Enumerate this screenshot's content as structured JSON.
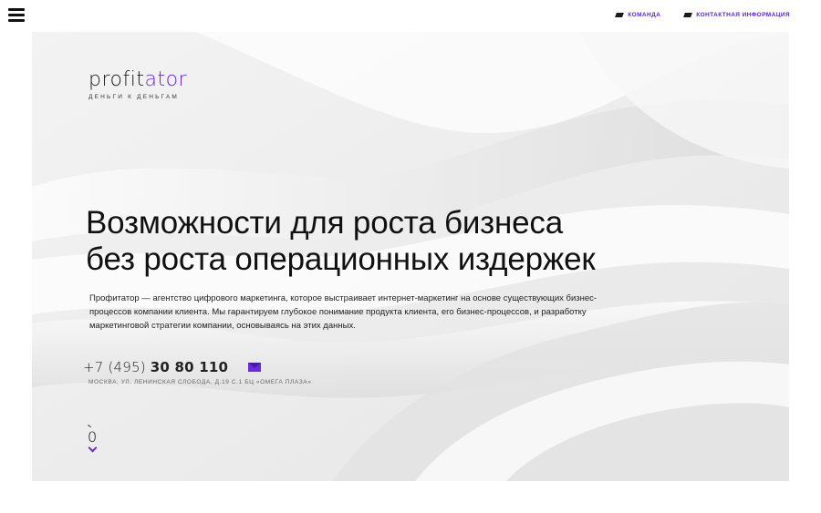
{
  "nav": {
    "menu_icon": "hamburger-icon",
    "links": [
      {
        "label": "КОМАНДА",
        "icon": "flag-icon"
      },
      {
        "label": "КОНТАКТНАЯ ИНФОРМАЦИЯ",
        "icon": "flag-icon"
      }
    ]
  },
  "hero": {
    "logo": {
      "prefix": "profit",
      "accent": "ator",
      "tagline": "ДЕНЬГИ К ДЕНЬГАМ"
    },
    "headline": {
      "line1": "Возможности для роста бизнеса",
      "line2": "без роста операционных издержек"
    },
    "description": "Профитатор — агентство цифрового маркетинга, которое выстраивает интернет-маркетинг на основе существующих бизнес-процессов компании клиента. Мы гарантируем глубокое понимание продукта клиента, его бизнес-процессов, и разработку маркетинговой стратегии компании, основываясь на этих данных.",
    "phone": {
      "prefix": "+7 (495) ",
      "number": "30 80 110"
    },
    "mail_icon": "envelope-icon",
    "address": "МОСКВА, УЛ. ЛЕНИНСКАЯ СЛОБОДА, Д.19 С.1 БЦ «ОМЕГА ПЛАЗА»",
    "scroll": {
      "value": "0",
      "icon": "chevron-down-icon"
    }
  },
  "colors": {
    "accent": "#6a2bd9",
    "background": "#ededed"
  }
}
